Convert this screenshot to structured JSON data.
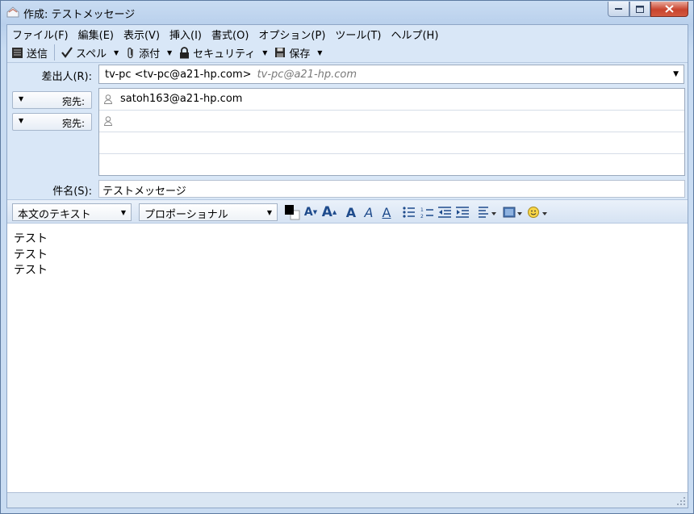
{
  "window": {
    "title": "作成: テストメッセージ"
  },
  "menu": [
    "ファイル(F)",
    "編集(E)",
    "表示(V)",
    "挿入(I)",
    "書式(O)",
    "オプション(P)",
    "ツール(T)",
    "ヘルプ(H)"
  ],
  "toolbar": {
    "send": "送信",
    "spell": "スペル",
    "attach": "添付",
    "security": "セキュリティ",
    "save": "保存"
  },
  "from": {
    "label": "差出人(R):",
    "value": "tv-pc <tv-pc@a21-hp.com>",
    "alias": "tv-pc@a21-hp.com"
  },
  "recipients": [
    {
      "type": "宛先:",
      "address": "satoh163@a21-hp.com"
    },
    {
      "type": "宛先:",
      "address": ""
    }
  ],
  "subject": {
    "label": "件名(S):",
    "value": "テストメッセージ"
  },
  "format": {
    "paragraph": "本文のテキスト",
    "font": "プロポーショナル",
    "text_color": "#000000"
  },
  "body": [
    "テスト",
    "テスト",
    "テスト"
  ]
}
